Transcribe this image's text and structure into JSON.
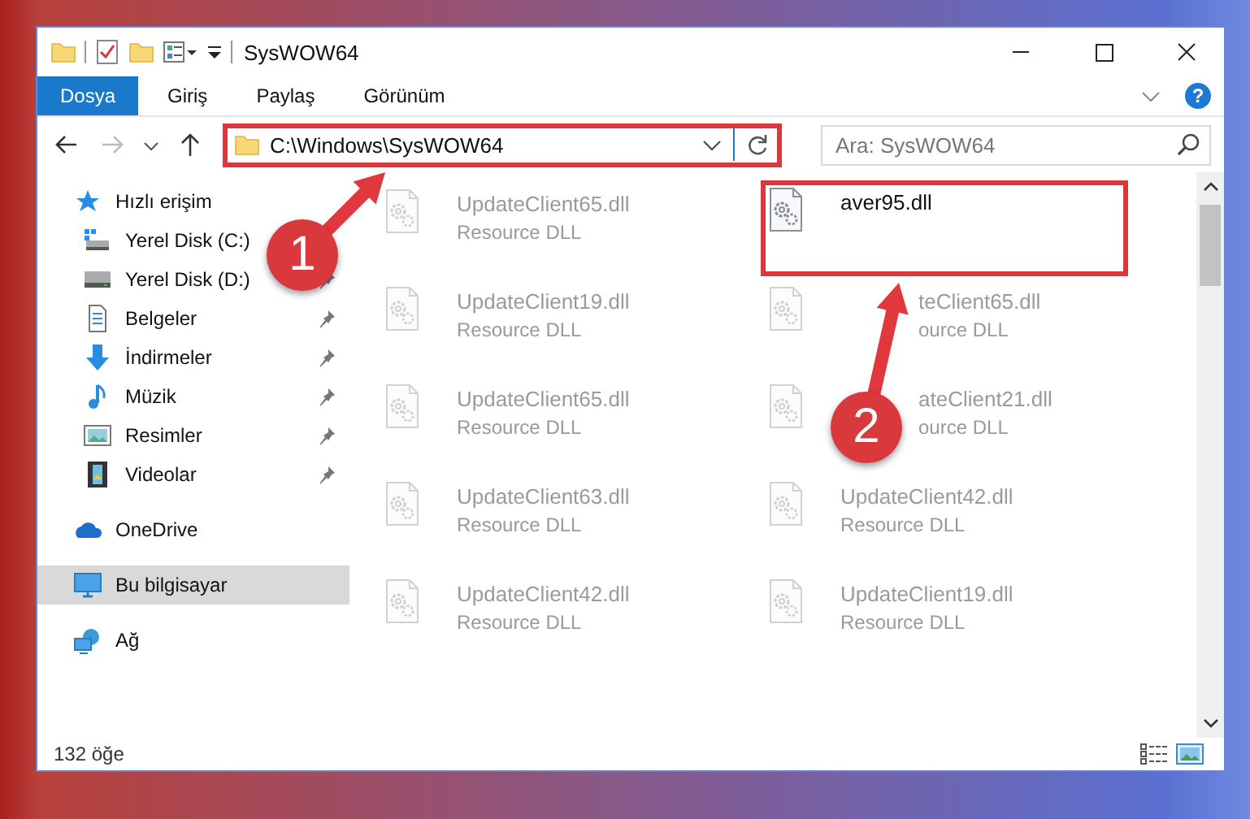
{
  "window": {
    "title": "SysWOW64"
  },
  "ribbon": {
    "tabs": [
      {
        "label": "Dosya",
        "kind": "file"
      },
      {
        "label": "Giriş",
        "kind": "tab"
      },
      {
        "label": "Paylaş",
        "kind": "tab"
      },
      {
        "label": "Görünüm",
        "kind": "tab"
      }
    ],
    "help": "?"
  },
  "address_bar": {
    "path": "C:\\Windows\\SysWOW64",
    "highlighted": true
  },
  "search": {
    "placeholder": "Ara: SysWOW64"
  },
  "sidebar": {
    "items": [
      {
        "label": "Hızlı erişim",
        "kind": "star",
        "pinned": false,
        "selected": false
      },
      {
        "label": "Yerel Disk (C:)",
        "kind": "drive-c",
        "pinned": false,
        "selected": false
      },
      {
        "label": "Yerel Disk (D:)",
        "kind": "drive",
        "pinned": true,
        "selected": false
      },
      {
        "label": "Belgeler",
        "kind": "docs",
        "pinned": true,
        "selected": false
      },
      {
        "label": "İndirmeler",
        "kind": "download",
        "pinned": true,
        "selected": false
      },
      {
        "label": "Müzik",
        "kind": "music",
        "pinned": true,
        "selected": false
      },
      {
        "label": "Resimler",
        "kind": "pictures",
        "pinned": true,
        "selected": false
      },
      {
        "label": "Videolar",
        "kind": "videos",
        "pinned": true,
        "selected": false
      },
      {
        "label": "OneDrive",
        "kind": "cloud",
        "pinned": false,
        "selected": false
      },
      {
        "label": "Bu bilgisayar",
        "kind": "pc",
        "pinned": false,
        "selected": true
      },
      {
        "label": "Ağ",
        "kind": "network",
        "pinned": false,
        "selected": false
      }
    ]
  },
  "files": [
    {
      "name": "UpdateClient65.dll",
      "type": "Resource DLL",
      "faded": true,
      "highlighted": false,
      "partly_hidden": false
    },
    {
      "name": "aver95.dll",
      "faded": false,
      "highlighted": true
    },
    {
      "name": "UpdateClient19.dll",
      "type": "Resource DLL",
      "faded": true,
      "highlighted": false,
      "partly_hidden": false
    },
    {
      "name": "teClient65.dll",
      "type": "ource DLL",
      "faded": true,
      "highlighted": false,
      "partly_hidden": true
    },
    {
      "name": "UpdateClient65.dll",
      "type": "Resource DLL",
      "faded": true,
      "highlighted": false,
      "partly_hidden": false
    },
    {
      "name": "ateClient21.dll",
      "type": "ource DLL",
      "faded": true,
      "highlighted": false,
      "partly_hidden": true
    },
    {
      "name": "UpdateClient63.dll",
      "type": "Resource DLL",
      "faded": true,
      "highlighted": false,
      "partly_hidden": false
    },
    {
      "name": "UpdateClient42.dll",
      "type": "Resource DLL",
      "faded": true,
      "highlighted": false,
      "partly_hidden": false
    },
    {
      "name": "UpdateClient42.dll",
      "type": "Resource DLL",
      "faded": true,
      "highlighted": false,
      "partly_hidden": false
    },
    {
      "name": "UpdateClient19.dll",
      "type": "Resource DLL",
      "faded": true,
      "highlighted": false,
      "partly_hidden": false
    }
  ],
  "status_bar": {
    "count": "132 öğe"
  },
  "annotations": [
    {
      "number": "1"
    },
    {
      "number": "2"
    }
  ]
}
